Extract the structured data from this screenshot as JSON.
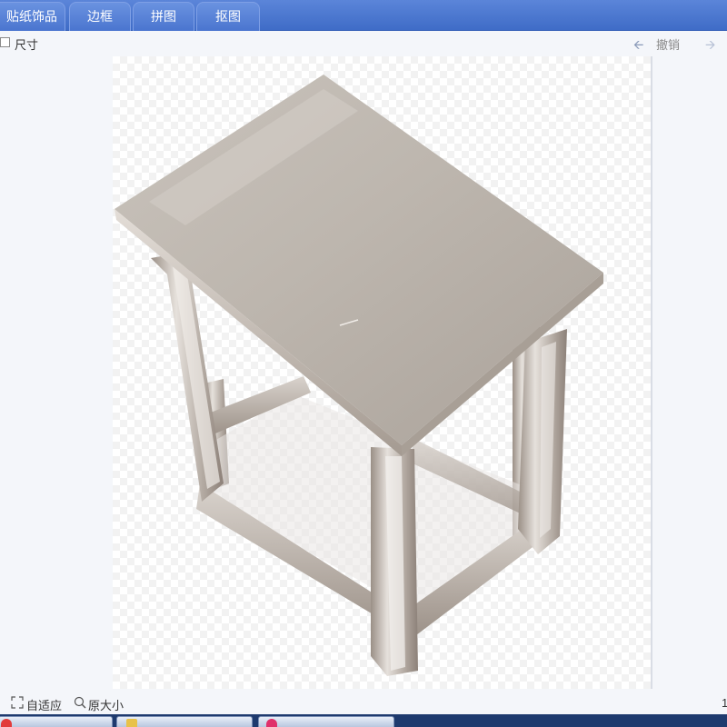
{
  "tabs": [
    {
      "label": "贴纸饰品"
    },
    {
      "label": "边框"
    },
    {
      "label": "拼图"
    },
    {
      "label": "抠图"
    }
  ],
  "toolbar": {
    "size_label": "尺寸",
    "undo_label": "撤销",
    "undo_icon": "arrow-left-icon",
    "redo_icon": "arrow-right-icon"
  },
  "canvas": {
    "image_subject": "stainless steel stool"
  },
  "bottom": {
    "fit_label": "自适应",
    "original_size_label": "原大小",
    "page_indicator": "1"
  },
  "taskbar": {
    "items": [
      {
        "icon": "red-app-icon",
        "color": "#e23b3b"
      },
      {
        "icon": "folder-icon",
        "color": "#e8c24a"
      },
      {
        "icon": "pink-app-icon",
        "color": "#e0306a"
      }
    ]
  },
  "colors": {
    "tabbar": "#4a75cf",
    "background": "#f4f6fa",
    "steel_light": "#d8d2cc",
    "steel_dark": "#8c8078"
  }
}
